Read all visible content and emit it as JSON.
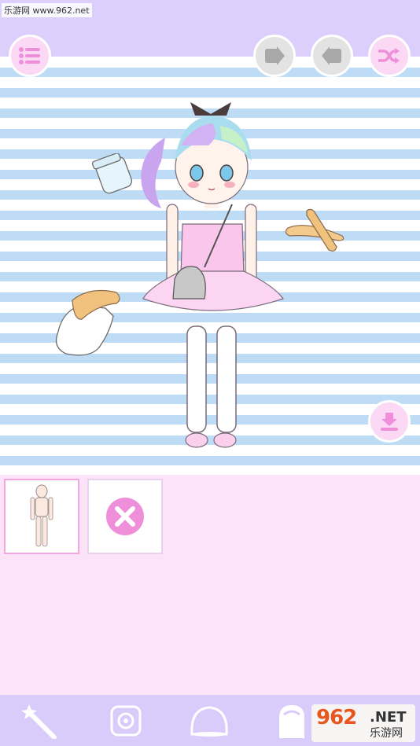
{
  "watermark": {
    "text": "乐游网 www.962.net"
  },
  "header": {
    "menu_icon": "list-icon",
    "undo_icon": "arrow-right-icon",
    "redo_icon": "arrow-left-icon",
    "shuffle_icon": "shuffle-icon"
  },
  "stage": {
    "character": "girl-doll",
    "items": [
      "jar-item",
      "bread-item",
      "glove-item"
    ],
    "download_icon": "download-icon"
  },
  "panel": {
    "slots": [
      {
        "name": "base-body-slot",
        "selected": true
      },
      {
        "name": "remove-item-slot",
        "icon": "close-icon"
      }
    ]
  },
  "bottom_tabs": [
    {
      "name": "magic-wand-tab",
      "icon": "magic-wand-icon"
    },
    {
      "name": "settings-tab",
      "icon": "gear-icon"
    },
    {
      "name": "slime-tab",
      "icon": "slime-icon"
    },
    {
      "name": "ghost-tab",
      "icon": "ghost-icon"
    }
  ],
  "logo": {
    "big": "962",
    "net": ".NET",
    "cn": "乐游网"
  },
  "colors": {
    "accent_pink": "#ef8fda",
    "stripe_blue": "#bfdcf6",
    "top_band": "#dccffb",
    "panel_bg": "#fde3f8",
    "bottom_bar": "#d9cbfa"
  }
}
